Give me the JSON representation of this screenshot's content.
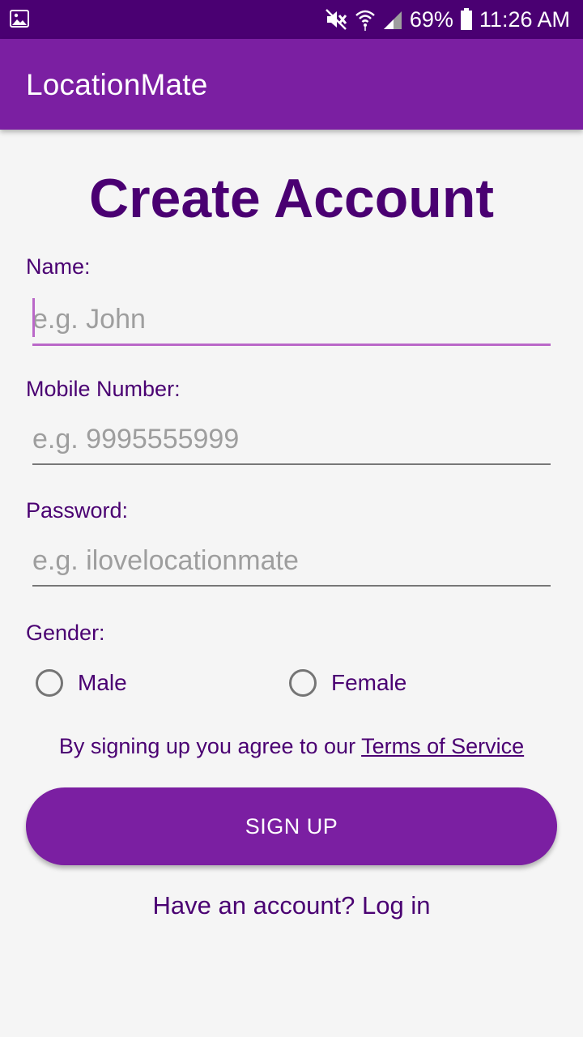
{
  "status_bar": {
    "battery": "69%",
    "time": "11:26 AM",
    "icons": [
      "gallery-icon",
      "mute-icon",
      "wifi-icon",
      "signal-icon",
      "battery-icon"
    ]
  },
  "app_bar": {
    "title": "LocationMate"
  },
  "form": {
    "title": "Create Account",
    "name": {
      "label": "Name:",
      "placeholder": "e.g. John",
      "value": ""
    },
    "mobile": {
      "label": "Mobile Number:",
      "placeholder": "e.g. 9995555999",
      "value": ""
    },
    "password": {
      "label": "Password:",
      "placeholder": "e.g. ilovelocationmate",
      "value": ""
    },
    "gender": {
      "label": "Gender:",
      "options": [
        "Male",
        "Female"
      ],
      "selected": ""
    },
    "terms_prefix": "By signing up you agree to our ",
    "terms_link": "Terms of Service",
    "signup_label": "SIGN UP",
    "login_link": "Have an account? Log in"
  },
  "colors": {
    "status_bar": "#4a0072",
    "primary": "#7b1fa2",
    "text_dark_purple": "#4a0072",
    "focus_accent": "#ba68c8",
    "background": "#f5f5f5"
  }
}
